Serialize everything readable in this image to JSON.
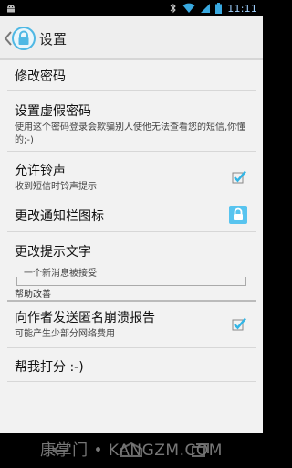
{
  "status_bar": {
    "time": "11:11",
    "icons": [
      "android-icon",
      "bluetooth-icon",
      "wifi-icon",
      "signal-icon",
      "battery-icon"
    ]
  },
  "action_bar": {
    "title": "设置"
  },
  "settings": {
    "change_password": {
      "title": "修改密码"
    },
    "fake_password": {
      "title": "设置虚假密码",
      "summary": "使用这个密码登录会欺骗别人使他无法查看您的短信,你懂的;-)"
    },
    "allow_ringtone": {
      "title": "允许铃声",
      "summary": "收到短信时铃声提示",
      "checked": true
    },
    "notification_icon": {
      "title": "更改通知栏图标"
    },
    "prompt_text": {
      "title": "更改提示文字",
      "value": "一个新消息被接受"
    },
    "help_section": {
      "title": "帮助改善"
    },
    "crash_report": {
      "title": "向作者发送匿名崩溃报告",
      "summary": "可能产生少部分网络费用",
      "checked": true
    },
    "rate": {
      "title": "帮我打分 :-)"
    }
  },
  "watermark": "康掌门 • KANGZM.COM",
  "colors": {
    "accent": "#33b5e5",
    "lock_icon_bg": "#58c4ef",
    "background": "#f2f2f2"
  }
}
